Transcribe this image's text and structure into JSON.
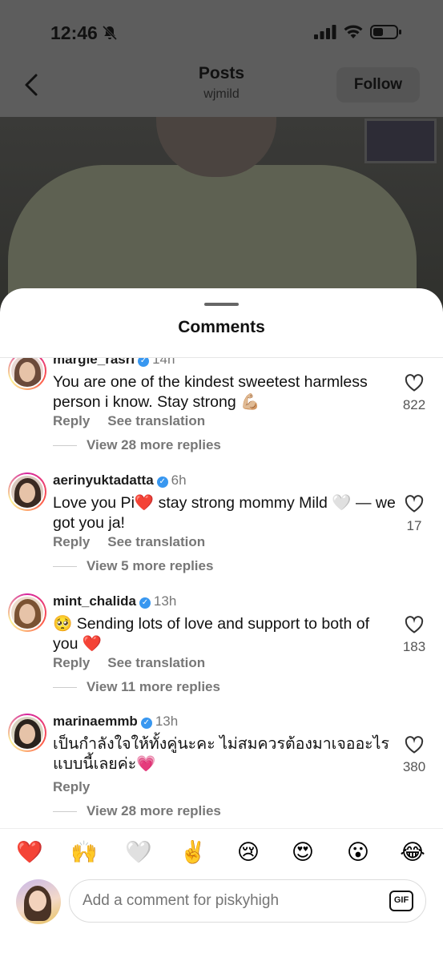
{
  "status_bar": {
    "time": "12:46"
  },
  "header": {
    "title": "Posts",
    "subtitle": "wjmild",
    "follow_label": "Follow"
  },
  "sheet": {
    "title": "Comments"
  },
  "comments": [
    {
      "username": "margie_rasri",
      "verified": true,
      "time": "14h",
      "text": "You are one of the kindest sweetest harmless person i know. Stay strong 💪🏼",
      "reply_label": "Reply",
      "translation_label": "See translation",
      "view_replies": "View 28 more replies",
      "likes": "822"
    },
    {
      "username": "aerinyuktadatta",
      "verified": true,
      "time": "6h",
      "text": "Love you Pi❤️ stay strong mommy Mild 🤍 — we got you ja!",
      "reply_label": "Reply",
      "translation_label": "See translation",
      "view_replies": "View 5 more replies",
      "likes": "17"
    },
    {
      "username": "mint_chalida",
      "verified": true,
      "time": "13h",
      "text": "🥺 Sending lots of love and support to both of you ❤️",
      "reply_label": "Reply",
      "translation_label": "See translation",
      "view_replies": "View 11 more replies",
      "likes": "183"
    },
    {
      "username": "marinaemmb",
      "verified": true,
      "time": "13h",
      "text": "เป็นกำลังใจให้ทั้งคู่นะคะ ไม่สมควรต้องมาเจออะไรแบบนี้เลยค่ะ💗",
      "reply_label": "Reply",
      "translation_label": "",
      "view_replies": "View 28 more replies",
      "likes": "380"
    }
  ],
  "emoji_bar": [
    "❤️",
    "🙌",
    "🤍",
    "✌️",
    "😢",
    "😍",
    "😮",
    "😂"
  ],
  "composer": {
    "placeholder": "Add a comment for piskyhigh",
    "gif_label": "GIF"
  },
  "colors": {
    "accent_blue": "#3897f0",
    "like_red": "#e0245e",
    "muted_text": "#777777"
  }
}
